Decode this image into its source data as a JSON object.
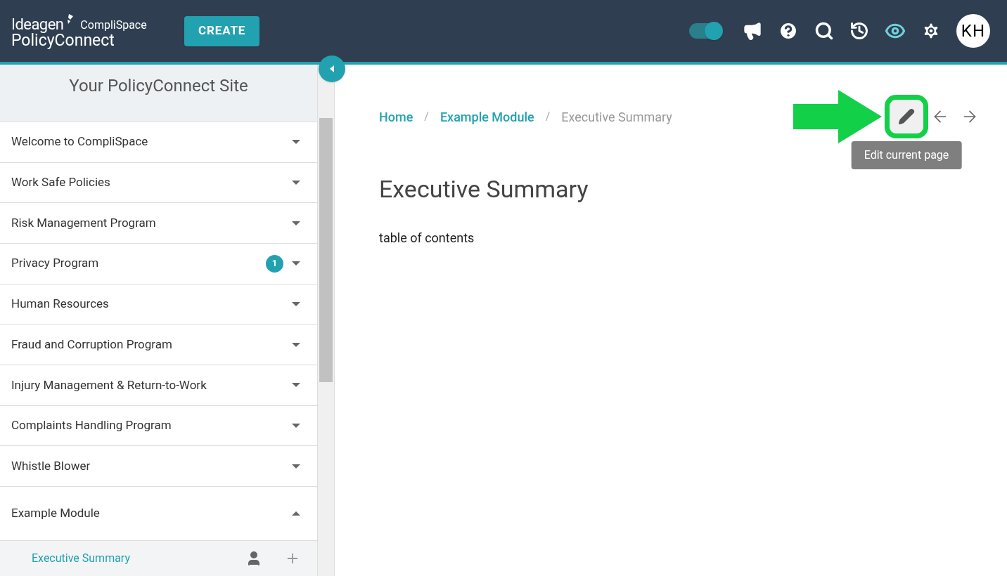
{
  "header": {
    "logo_top": "Ideagen",
    "logo_sub": "CompliSpace",
    "logo_product": "PolicyConnect",
    "create_button": "CREATE",
    "toggle": {
      "on": true
    },
    "preview": {
      "on": true
    },
    "avatar": "KH"
  },
  "sidebar": {
    "title": "Your PolicyConnect Site",
    "items": [
      {
        "label": "Welcome to CompliSpace",
        "expanded": false
      },
      {
        "label": "Work Safe Policies",
        "expanded": false
      },
      {
        "label": "Risk Management Program",
        "expanded": false
      },
      {
        "label": "Privacy Program",
        "expanded": false,
        "badge": "1"
      },
      {
        "label": "Human Resources",
        "expanded": false
      },
      {
        "label": "Fraud and Corruption Program",
        "expanded": false
      },
      {
        "label": "Injury Management & Return-to-Work",
        "expanded": false
      },
      {
        "label": "Complaints Handling Program",
        "expanded": false
      },
      {
        "label": "Whistle Blower",
        "expanded": false
      },
      {
        "label": "Example Module",
        "expanded": true,
        "children": [
          {
            "label": "Executive Summary",
            "selected": true
          }
        ]
      }
    ]
  },
  "breadcrumb_separator": "/",
  "breadcrumb": [
    {
      "label": "Home",
      "current": false
    },
    {
      "label": "Example Module",
      "current": false
    },
    {
      "label": "Executive Summary",
      "current": true
    }
  ],
  "tooltip": "Edit current page",
  "page": {
    "title": "Executive Summary",
    "body": "table of contents"
  }
}
